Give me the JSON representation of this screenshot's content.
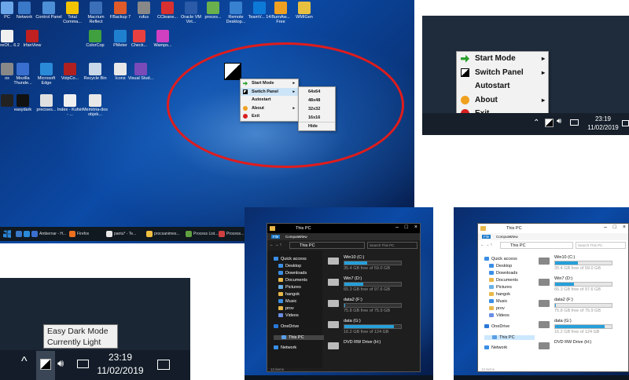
{
  "desktop": {
    "icons": [
      {
        "label": "PC",
        "color": "#6aa6e8"
      },
      {
        "label": "Network",
        "color": "#3a78c8"
      },
      {
        "label": "Control Panel",
        "color": "#4d8fd6"
      },
      {
        "label": "Total Comma...",
        "color": "#f2c400"
      },
      {
        "label": "Macrium Reflect",
        "color": "#3b6fb8"
      },
      {
        "label": "FBackup 7",
        "color": "#e05a2a"
      },
      {
        "label": "rufus",
        "color": "#888888"
      },
      {
        "label": "CCleane...",
        "color": "#d83030"
      },
      {
        "label": "Oracle VM Virt...",
        "color": "#2a5aa8"
      },
      {
        "label": "proces...",
        "color": "#6ab04c"
      },
      {
        "label": "Remote Desktop...",
        "color": "#3880d0"
      },
      {
        "label": "TeamV... 14",
        "color": "#0e7ad8"
      },
      {
        "label": "BurnAw... Free",
        "color": "#f0a020"
      },
      {
        "label": "WMIGen",
        "color": "#e8c040"
      },
      {
        "label": "LibreOf... 6.2",
        "color": "#f0f0f0"
      },
      {
        "label": "IrfanView",
        "color": "#c02020"
      },
      {
        "label": "ColorCop",
        "color": "#40a040"
      },
      {
        "label": "PMeter",
        "color": "#2080d0"
      },
      {
        "label": "Check...",
        "color": "#e84040"
      },
      {
        "label": "Wamps...",
        "color": "#d040c0"
      },
      {
        "label": "ox",
        "color": "#888888"
      },
      {
        "label": "Mozilla Thunde...",
        "color": "#3a6fd0"
      },
      {
        "label": "Microsoft Edge",
        "color": "#2a8ad8"
      },
      {
        "label": "VoipCo...",
        "color": "#b02020"
      },
      {
        "label": "Recycle Bin",
        "color": "#c8d8e8"
      },
      {
        "label": "Icons",
        "color": "#e8e8e8"
      },
      {
        "label": "Visual Stud...",
        "color": "#7a4ab8"
      },
      {
        "label": "",
        "color": "#222222"
      },
      {
        "label": "easydark",
        "color": "#111111"
      },
      {
        "label": "precises...",
        "color": "#e0e0e0"
      },
      {
        "label": "Index - Kufsir - ...",
        "color": "#f0f0f0"
      },
      {
        "label": "Memória-dos objek...",
        "color": "#e8e8e8"
      }
    ],
    "context_menu": {
      "items": [
        {
          "label": "Start Mode",
          "icon": "green-arrow-icon",
          "arrow": "▸"
        },
        {
          "label": "Switch Panel",
          "icon": "dark-light-square-icon",
          "arrow": "▸"
        },
        {
          "label": "Autostart",
          "icon": "",
          "arrow": ""
        },
        {
          "label": "About",
          "icon": "info-icon",
          "arrow": "▸"
        },
        {
          "label": "Exit",
          "icon": "exit-icon",
          "arrow": ""
        }
      ]
    },
    "submenu": {
      "items": [
        "64x64",
        "48x48",
        "32x32",
        "16x16",
        "Hide"
      ]
    },
    "taskbar": {
      "items": [
        {
          "label": "",
          "color": "#3a78c8"
        },
        {
          "label": "",
          "color": "#2a8ad8"
        },
        {
          "label": "Ambernar - H...",
          "color": "#3a6fd0"
        },
        {
          "label": "Firefox",
          "color": "#f07020"
        },
        {
          "label": "pantu* - Te...",
          "color": "#e8e8e8"
        },
        {
          "label": "procsanimes...",
          "color": "#f0c040"
        },
        {
          "label": "Process List...",
          "color": "#60a040"
        },
        {
          "label": "Process...",
          "color": "#d04040"
        }
      ]
    }
  },
  "tray_menu": {
    "items": [
      {
        "label": "Start Mode",
        "icon": "green-arrow-icon",
        "arrow": "▸"
      },
      {
        "label": "Switch Panel",
        "icon": "dark-light-square-icon",
        "arrow": "▸"
      },
      {
        "label": "Autostart",
        "icon": "",
        "arrow": ""
      },
      {
        "label": "About",
        "icon": "info-icon",
        "arrow": "▸"
      },
      {
        "label": "Exit",
        "icon": "exit-icon",
        "arrow": ""
      }
    ],
    "time": "23:19",
    "date": "11/02/2019"
  },
  "tooltip": {
    "line1": "Easy Dark Mode",
    "line2": "Currently Light",
    "time": "23:19",
    "date": "11/02/2019"
  },
  "explorer_dark": {
    "title": "This PC",
    "tabs": [
      "File",
      "Computer",
      "View"
    ],
    "address": "This PC",
    "search_placeholder": "Search This PC",
    "nav": [
      "Quick access",
      "Desktop",
      "Downloads",
      "Documents",
      "Pictures",
      "hangok",
      "Music",
      "prov",
      "Videos",
      "OneDrive",
      "This PC",
      "Network"
    ],
    "drives": [
      {
        "name": "Win10 (C:)",
        "free": "35.4 GB free of 59.0 GB",
        "used_fraction": 0.4
      },
      {
        "name": "Win7 (D:)",
        "free": "65.3 GB free of 97.6 GB",
        "used_fraction": 0.33
      },
      {
        "name": "data2 (F:)",
        "free": "75.8 GB free of 75.9 GB",
        "used_fraction": 0.01
      },
      {
        "name": "data (G:)",
        "free": "16.2 GB free of 124 GB",
        "used_fraction": 0.87
      },
      {
        "name": "DVD RW Drive (H:)",
        "free": "",
        "used_fraction": 0
      }
    ],
    "status": "12 items"
  },
  "explorer_light": {
    "title": "This PC",
    "tabs": [
      "File",
      "Computer",
      "View"
    ],
    "address": "This PC",
    "search_placeholder": "Search This PC",
    "nav": [
      "Quick access",
      "Desktop",
      "Downloads",
      "Documents",
      "Pictures",
      "hangok",
      "Music",
      "prov",
      "Videos",
      "OneDrive",
      "This PC",
      "Network"
    ],
    "drives": [
      {
        "name": "Win10 (C:)",
        "free": "35.4 GB free of 59.0 GB",
        "used_fraction": 0.4
      },
      {
        "name": "Win7 (D:)",
        "free": "65.3 GB free of 97.6 GB",
        "used_fraction": 0.33
      },
      {
        "name": "data2 (F:)",
        "free": "75.8 GB free of 75.9 GB",
        "used_fraction": 0.01
      },
      {
        "name": "data (G:)",
        "free": "16.2 GB free of 124 GB",
        "used_fraction": 0.87
      },
      {
        "name": "DVD RW Drive (H:)",
        "free": "",
        "used_fraction": 0
      }
    ],
    "status": "12 items"
  }
}
